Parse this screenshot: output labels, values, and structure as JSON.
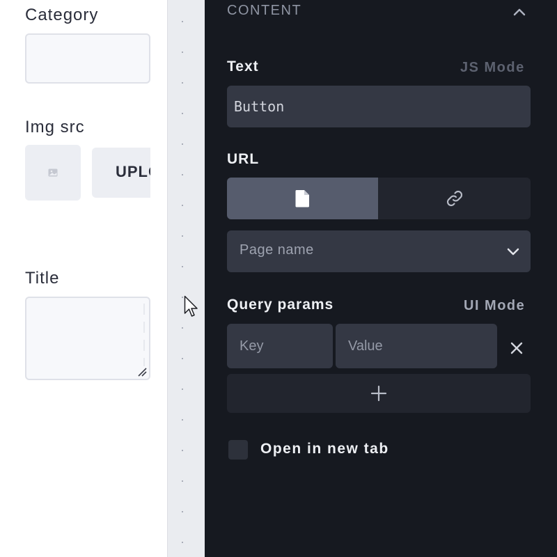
{
  "left_form": {
    "category_label": "Category",
    "category_value": "",
    "img_src_label": "Img src",
    "upload_label": "UPLOAD",
    "title_label": "Title",
    "title_value": ""
  },
  "content_panel": {
    "section_title": "CONTENT",
    "text": {
      "label": "Text",
      "mode_toggle": "JS Mode",
      "value": "Button"
    },
    "url": {
      "label": "URL",
      "options": [
        {
          "icon": "page-icon",
          "selected": true
        },
        {
          "icon": "link-icon",
          "selected": false
        }
      ],
      "page_select_placeholder": "Page name"
    },
    "query_params": {
      "label": "Query params",
      "mode_toggle": "UI Mode",
      "key_placeholder": "Key",
      "value_placeholder": "Value"
    },
    "open_new_tab": {
      "label": "Open in new tab",
      "checked": false
    }
  },
  "colors": {
    "panel_bg": "#161920",
    "input_bg": "#343844",
    "toggle_active": "#565c6d",
    "muted_text": "#8f95a3"
  }
}
